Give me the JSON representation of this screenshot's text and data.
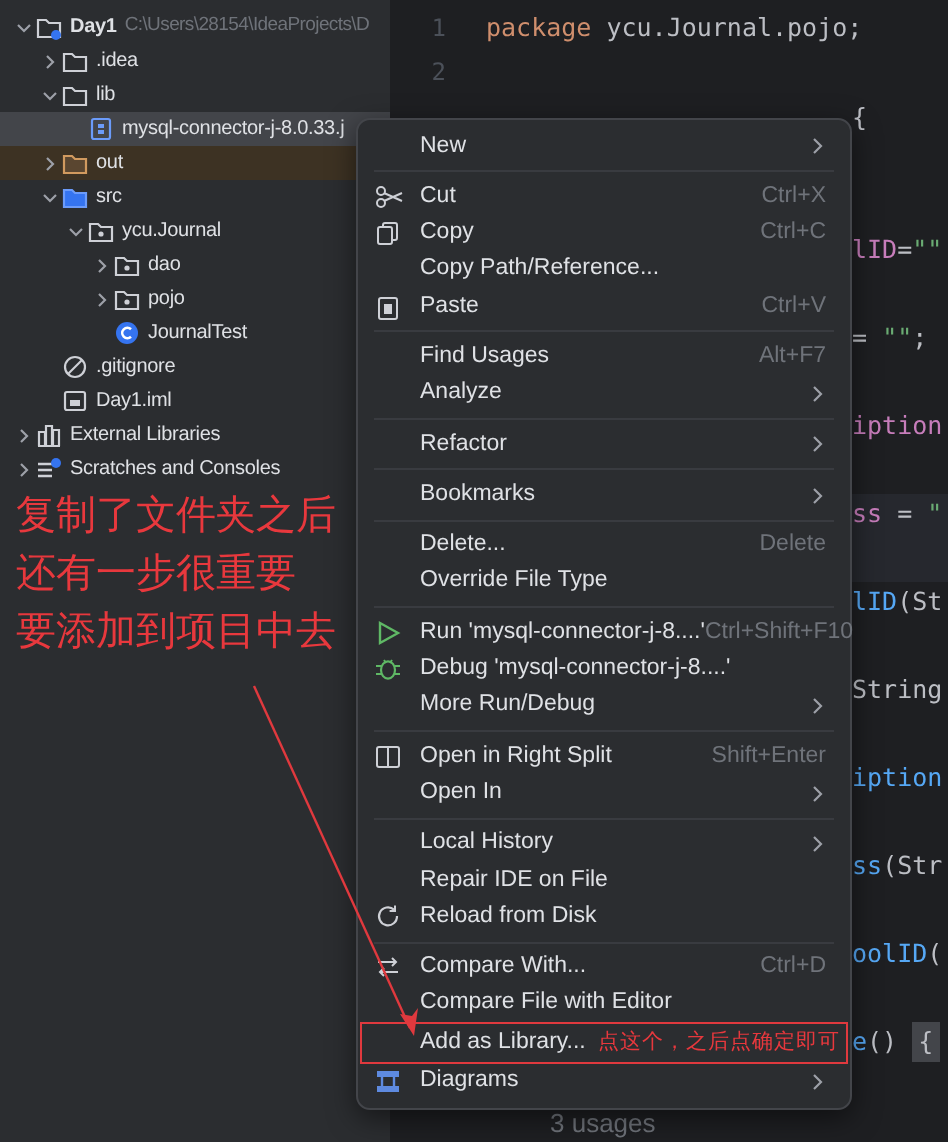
{
  "project_tree": [
    {
      "label": "Day1",
      "hint": "C:\\Users\\28154\\IdeaProjects\\D",
      "kind": "project",
      "expanded": true,
      "selected": false,
      "children": [
        {
          "label": ".idea",
          "kind": "folder",
          "expanded": false,
          "selected": false
        },
        {
          "label": "lib",
          "kind": "folder",
          "expanded": true,
          "selected": false,
          "children": [
            {
              "label": "mysql-connector-j-8.0.33.j",
              "kind": "jar",
              "selected": true
            }
          ]
        },
        {
          "label": "out",
          "kind": "excluded",
          "expanded": false,
          "selected": false
        },
        {
          "label": "src",
          "kind": "source",
          "expanded": true,
          "selected": false,
          "children": [
            {
              "label": "ycu.Journal",
              "kind": "package",
              "expanded": true,
              "selected": false,
              "children": [
                {
                  "label": "dao",
                  "kind": "package",
                  "expanded": false,
                  "selected": false
                },
                {
                  "label": "pojo",
                  "kind": "package",
                  "expanded": false,
                  "selected": false
                },
                {
                  "label": "JournalTest",
                  "kind": "class",
                  "selected": false
                }
              ]
            }
          ]
        },
        {
          "label": ".gitignore",
          "kind": "ignore",
          "selected": false
        },
        {
          "label": "Day1.iml",
          "kind": "module",
          "selected": false
        }
      ]
    },
    {
      "label": "External Libraries",
      "kind": "libraries",
      "expanded": false,
      "selected": false
    },
    {
      "label": "Scratches and Consoles",
      "kind": "scratches",
      "expanded": false,
      "selected": false
    }
  ],
  "editor": {
    "line_numbers": [
      "1",
      "2"
    ],
    "first_line": [
      {
        "text": "package",
        "kind": "keyword"
      },
      {
        "text": " ycu.Journal.pojo;",
        "kind": "plain"
      }
    ],
    "visible_fragments": [
      {
        "tokens": [
          {
            "text": "{",
            "kind": "plain"
          }
        ],
        "current": false
      },
      {
        "tokens": [
          {
            "text": "lID",
            "kind": "field"
          },
          {
            "text": "=",
            "kind": "plain"
          },
          {
            "text": "\"\"",
            "kind": "string"
          }
        ],
        "current": false
      },
      {
        "tokens": [
          {
            "text": "= ",
            "kind": "plain"
          },
          {
            "text": "\"\"",
            "kind": "string"
          },
          {
            "text": ";",
            "kind": "plain"
          }
        ],
        "current": false
      },
      {
        "tokens": [
          {
            "text": "iption",
            "kind": "field"
          }
        ],
        "current": false
      },
      {
        "tokens": [
          {
            "text": "ss",
            "kind": "field"
          },
          {
            "text": " = ",
            "kind": "plain"
          },
          {
            "text": "\"",
            "kind": "string"
          }
        ],
        "current": true
      },
      {
        "tokens": [
          {
            "text": "lID",
            "kind": "method"
          },
          {
            "text": "(St",
            "kind": "plain"
          }
        ],
        "current": false
      },
      {
        "tokens": [
          {
            "text": "String",
            "kind": "plain"
          }
        ],
        "current": false
      },
      {
        "tokens": [
          {
            "text": "iption",
            "kind": "method"
          }
        ],
        "current": false
      },
      {
        "tokens": [
          {
            "text": "ss",
            "kind": "method"
          },
          {
            "text": "(Str",
            "kind": "plain"
          }
        ],
        "current": false
      },
      {
        "tokens": [
          {
            "text": "oolID",
            "kind": "method"
          },
          {
            "text": "(",
            "kind": "plain"
          }
        ],
        "current": false
      },
      {
        "tokens": [
          {
            "text": "e",
            "kind": "method"
          },
          {
            "text": "() ",
            "kind": "plain"
          },
          {
            "text": "{",
            "kind": "matched"
          }
        ],
        "current": false
      }
    ],
    "usages_hint": "3 usages"
  },
  "context_menu": [
    {
      "kind": "item",
      "label": "New",
      "submenu": true
    },
    {
      "kind": "separator"
    },
    {
      "kind": "cut",
      "label": "Cut",
      "shortcut": "Ctrl+X"
    },
    {
      "kind": "copy",
      "label": "Copy",
      "shortcut": "Ctrl+C"
    },
    {
      "kind": "item",
      "label": "Copy Path/Reference..."
    },
    {
      "kind": "paste",
      "label": "Paste",
      "shortcut": "Ctrl+V"
    },
    {
      "kind": "separator"
    },
    {
      "kind": "item",
      "label": "Find Usages",
      "shortcut": "Alt+F7"
    },
    {
      "kind": "item",
      "label": "Analyze",
      "submenu": true
    },
    {
      "kind": "separator"
    },
    {
      "kind": "item",
      "label": "Refactor",
      "submenu": true
    },
    {
      "kind": "separator"
    },
    {
      "kind": "item",
      "label": "Bookmarks",
      "submenu": true
    },
    {
      "kind": "separator"
    },
    {
      "kind": "item",
      "label": "Delete...",
      "shortcut": "Delete"
    },
    {
      "kind": "item",
      "label": "Override File Type"
    },
    {
      "kind": "separator"
    },
    {
      "kind": "run",
      "label": "Run 'mysql-connector-j-8....'",
      "shortcut": "Ctrl+Shift+F10"
    },
    {
      "kind": "debug",
      "label": "Debug 'mysql-connector-j-8....'"
    },
    {
      "kind": "item",
      "label": "More Run/Debug",
      "submenu": true
    },
    {
      "kind": "separator"
    },
    {
      "kind": "split",
      "label": "Open in Right Split",
      "shortcut": "Shift+Enter"
    },
    {
      "kind": "item",
      "label": "Open In",
      "submenu": true
    },
    {
      "kind": "separator"
    },
    {
      "kind": "item",
      "label": "Local History",
      "submenu": true
    },
    {
      "kind": "item",
      "label": "Repair IDE on File"
    },
    {
      "kind": "reload",
      "label": "Reload from Disk"
    },
    {
      "kind": "separator"
    },
    {
      "kind": "compare",
      "label": "Compare With...",
      "shortcut": "Ctrl+D"
    },
    {
      "kind": "item",
      "label": "Compare File with Editor"
    },
    {
      "kind": "item",
      "label": "Add as Library...",
      "callout": "点这个，之后点确定即可"
    },
    {
      "kind": "diagram",
      "label": "Diagrams",
      "submenu": true
    }
  ],
  "annotation": {
    "note_lines": [
      "复制了文件夹之后",
      "还有一步很重要",
      "要添加到项目中去"
    ]
  }
}
